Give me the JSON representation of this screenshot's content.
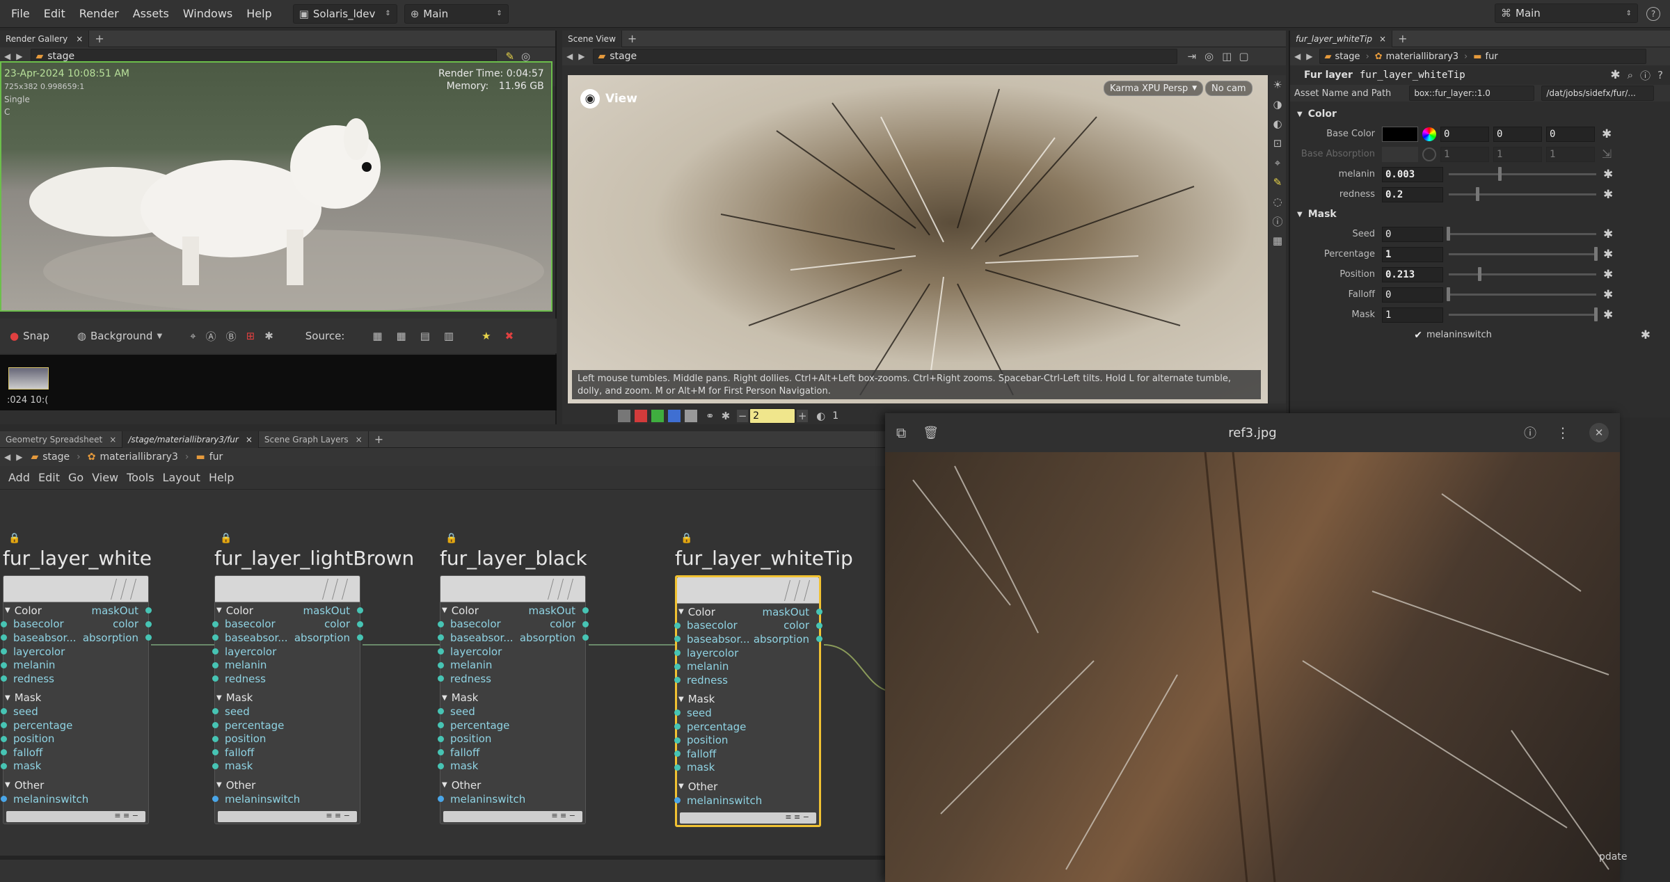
{
  "menubar": {
    "items": [
      "File",
      "Edit",
      "Render",
      "Assets",
      "Windows",
      "Help"
    ],
    "desktop": "Solaris_ldev",
    "context": "Main",
    "right_context": "Main"
  },
  "render_gallery": {
    "tab": "Render Gallery",
    "path": "stage",
    "camera_field": "C",
    "timestamp": "23-Apr-2024 10:08:51 AM",
    "resolution": "725x382 0.998659:1",
    "mode": "Single",
    "mode_sub": "C",
    "render_time_label": "Render Time:",
    "render_time": "0:04:57",
    "memory_label": "Memory:",
    "memory": "11.96 GB",
    "snap": "Snap",
    "background": "Background",
    "source": "Source:",
    "thumb_caption": ":024 10:("
  },
  "scene_view": {
    "tab": "Scene View",
    "path": "stage",
    "view_label": "View",
    "renderer": "Karma XPU Persp",
    "camera": "No cam",
    "help_text": "Left mouse tumbles. Middle pans. Right dollies. Ctrl+Alt+Left box-zooms. Ctrl+Right zooms. Spacebar-Ctrl-Left tilts. Hold L for alternate tumble, dolly, and zoom. M or Alt+M for First Person Navigation.",
    "frame_value": "2",
    "frame_count": "1"
  },
  "params": {
    "tab": "fur_layer_whiteTip",
    "crumbs": [
      "stage",
      "materiallibrary3",
      "fur"
    ],
    "type_label": "Fur layer",
    "node_name": "fur_layer_whiteTip",
    "asset_label": "Asset Name and Path",
    "asset_name": "box::fur_layer::1.0",
    "asset_path": "/dat/jobs/sidefx/fur/...",
    "sections": {
      "color": "Color",
      "mask": "Mask"
    },
    "base_color": {
      "label": "Base Color",
      "values": [
        "0",
        "0",
        "0"
      ]
    },
    "base_absorption": {
      "label": "Base Absorption",
      "values": [
        "1",
        "1",
        "1"
      ]
    },
    "melanin": {
      "label": "melanin",
      "value": "0.003",
      "level": 0.35
    },
    "redness": {
      "label": "redness",
      "value": "0.2",
      "level": 0.2
    },
    "seed": {
      "label": "Seed",
      "value": "0",
      "level": 0
    },
    "percentage": {
      "label": "Percentage",
      "value": "1",
      "level": 1
    },
    "position": {
      "label": "Position",
      "value": "0.213",
      "level": 0.213
    },
    "falloff": {
      "label": "Falloff",
      "value": "0",
      "level": 0
    },
    "mask": {
      "label": "Mask",
      "value": "1",
      "level": 1
    },
    "melaninswitch": "melaninswitch"
  },
  "network": {
    "tabs": [
      "Geometry Spreadsheet",
      "/stage/materiallibrary3/fur",
      "Scene Graph Layers"
    ],
    "crumbs": [
      "stage",
      "materiallibrary3",
      "fur"
    ],
    "menu": [
      "Add",
      "Edit",
      "Go",
      "View",
      "Tools",
      "Layout",
      "Help"
    ],
    "port_labels": {
      "color_section": "Color",
      "mask_section": "Mask",
      "other_section": "Other",
      "inputs_color": [
        "basecolor",
        "baseabsor...",
        "layercolor",
        "melanin",
        "redness"
      ],
      "outputs": [
        "maskOut",
        "color",
        "absorption"
      ],
      "inputs_mask": [
        "seed",
        "percentage",
        "position",
        "falloff",
        "mask"
      ],
      "inputs_other": [
        "melaninswitch"
      ]
    },
    "nodes": [
      {
        "name": "fur_layer_white"
      },
      {
        "name": "fur_layer_lightBrown"
      },
      {
        "name": "fur_layer_black"
      },
      {
        "name": "fur_layer_whiteTip"
      }
    ]
  },
  "viewer": {
    "title": "ref3.jpg",
    "bottom_right": "pdate"
  },
  "colors": {
    "accent_green": "#6cbf4b",
    "selected_node": "#f1c232",
    "port": "#47c4b4"
  }
}
